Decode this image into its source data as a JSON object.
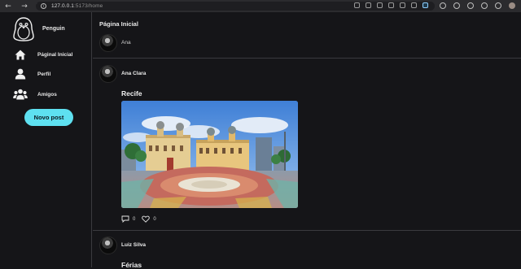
{
  "browser": {
    "url_host": "127.0.0.1",
    "url_path": ":5173/home"
  },
  "sidebar": {
    "brand": "Penguin",
    "items": [
      {
        "label": "Páginal Inicial",
        "icon": "home-icon"
      },
      {
        "label": "Perfil",
        "icon": "user-icon"
      },
      {
        "label": "Amigos",
        "icon": "friends-icon"
      }
    ],
    "new_post": "Novo post"
  },
  "main": {
    "title": "Página Inicial",
    "composer_user": "Ana",
    "posts": [
      {
        "author": "Ana Clara",
        "title": "Recife",
        "comments": "0",
        "likes": "0"
      },
      {
        "author": "Luiz Silva",
        "title": "Férias"
      }
    ]
  },
  "colors": {
    "accent": "#5ee0f0",
    "background": "#151518",
    "divider": "#3a3a3f"
  }
}
